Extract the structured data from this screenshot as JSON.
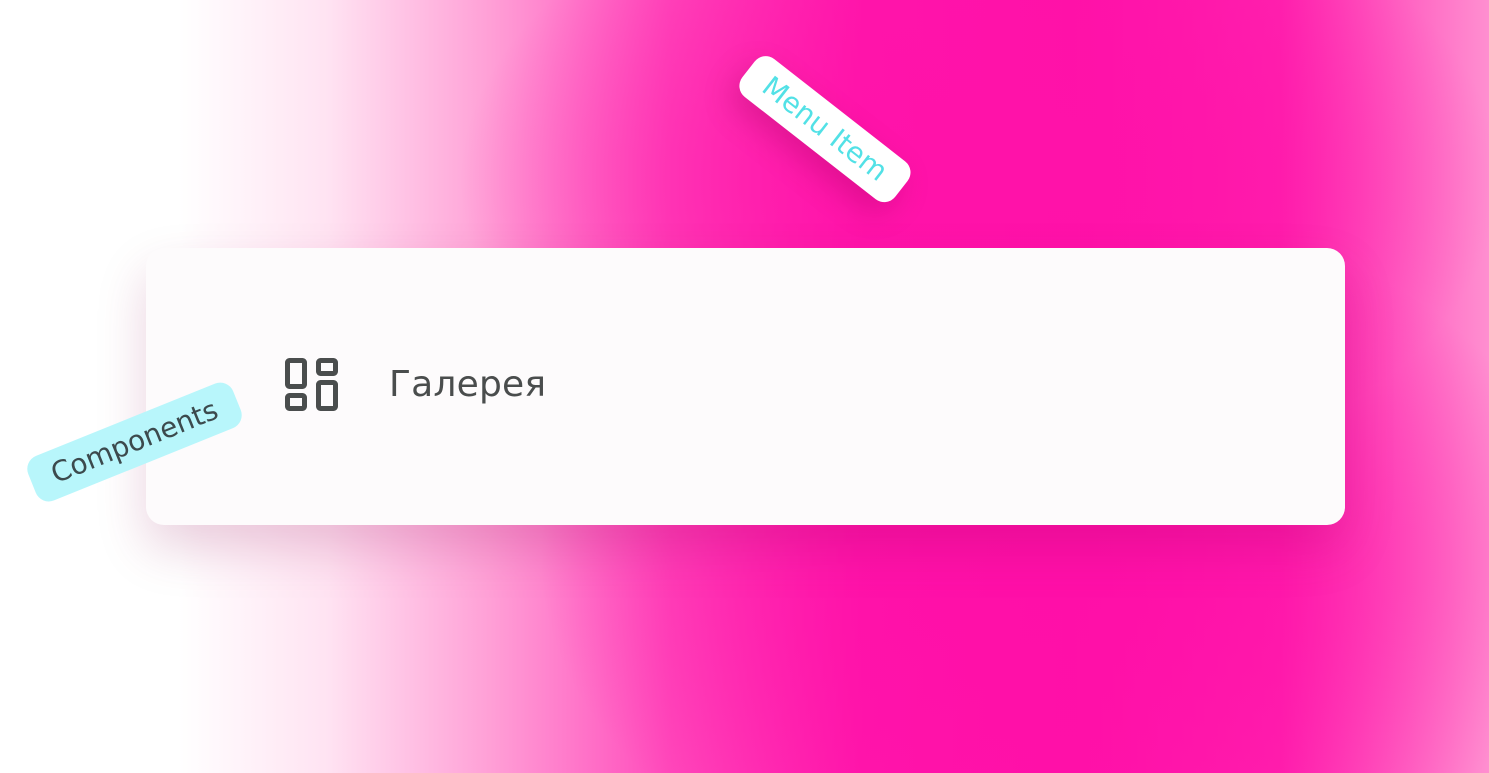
{
  "menu_item": {
    "label": "Галерея",
    "icon": "dashboard-icon"
  },
  "tags": {
    "menu_item": "Menu Item",
    "components": "Components"
  },
  "colors": {
    "background_accent": "#ff10a8",
    "card_background": "#fdfbfc",
    "text_primary": "#4a4d4d",
    "tag_cyan_bg": "#b8f6fb",
    "tag_cyan_text": "#52e1e6"
  }
}
